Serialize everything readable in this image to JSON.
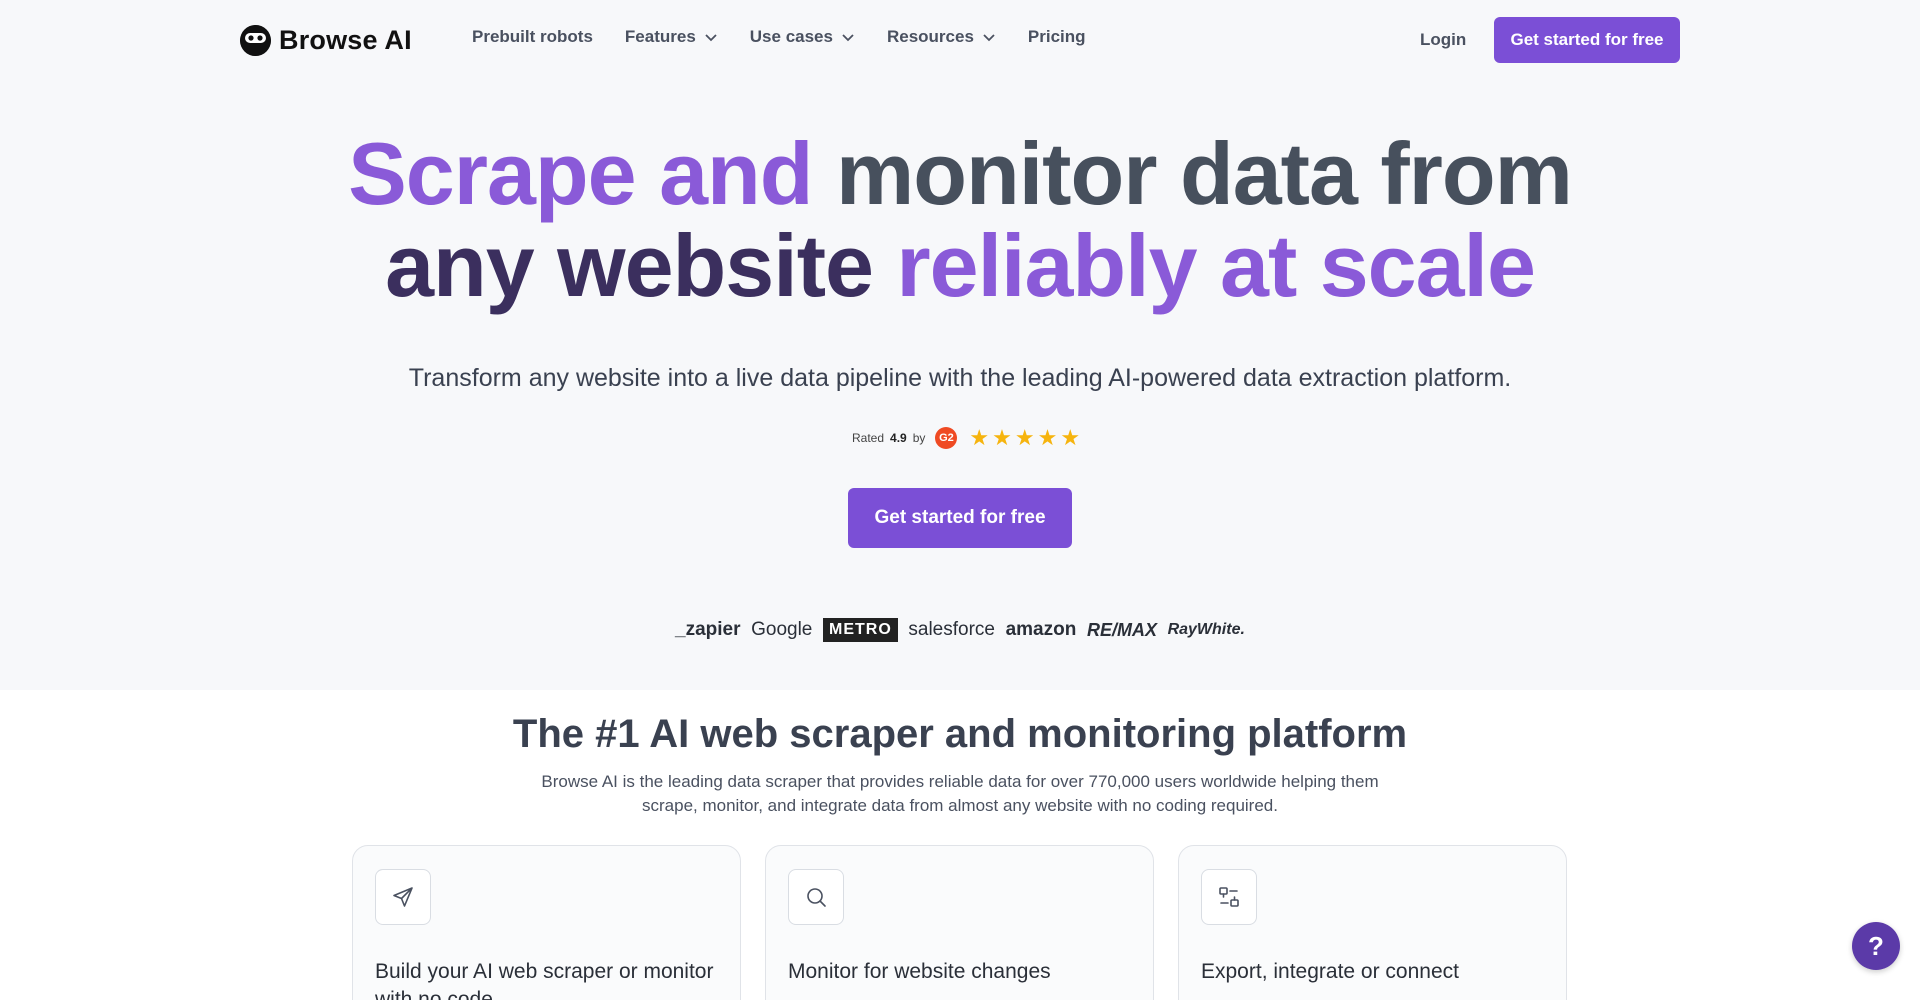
{
  "brand": {
    "name": "Browse AI"
  },
  "nav": {
    "items": [
      {
        "label": "Prebuilt robots",
        "dropdown": false
      },
      {
        "label": "Features",
        "dropdown": true
      },
      {
        "label": "Use cases",
        "dropdown": true
      },
      {
        "label": "Resources",
        "dropdown": true
      },
      {
        "label": "Pricing",
        "dropdown": false
      }
    ],
    "login_label": "Login",
    "cta_label": "Get started for free"
  },
  "hero": {
    "headline_line1": [
      "Scrape",
      "and",
      "monitor",
      "data",
      "from"
    ],
    "headline_line2": [
      "any",
      "website",
      "reliably",
      "at",
      "scale"
    ],
    "subtitle": "Transform any website into a live data pipeline with the leading AI-powered data extraction platform.",
    "rating_prefix": "Rated",
    "rating_value": "4.9",
    "rating_suffix": "by",
    "rating_badge": "G2",
    "stars": 5,
    "cta_label": "Get started for free"
  },
  "customer_logos": [
    "_zapier",
    "Google",
    "METRO",
    "salesforce",
    "amazon",
    "RE/MAX",
    "RayWhite."
  ],
  "section": {
    "title": "The #1 AI web scraper and monitoring platform",
    "description": "Browse AI is the leading data scraper that provides reliable data for over 770,000 users worldwide helping them scrape, monitor, and integrate data from almost any website with no coding required.",
    "cards": [
      {
        "icon": "send-icon",
        "title": "Build your AI web scraper or monitor with no code"
      },
      {
        "icon": "search-icon",
        "title": "Monitor for website changes"
      },
      {
        "icon": "integration-icon",
        "title": "Export, integrate or connect"
      }
    ]
  },
  "help_label": "?",
  "colors": {
    "accent": "#7b4fd6",
    "headline_purple": "#8a5ad8",
    "headline_slate": "#47505d",
    "headline_dark": "#3b2f5e",
    "star": "#f6b40e",
    "help_bubble": "#5b3aa8"
  }
}
